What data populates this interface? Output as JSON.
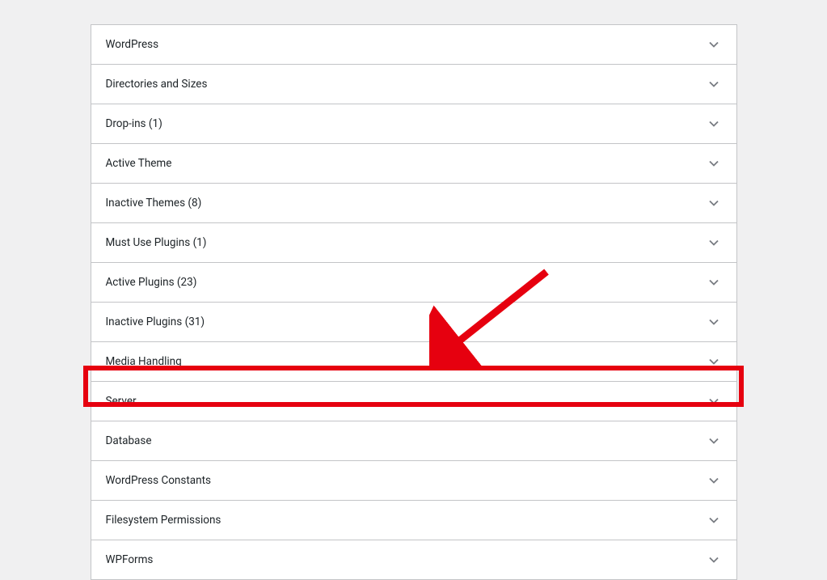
{
  "sections": [
    {
      "label": "WordPress"
    },
    {
      "label": "Directories and Sizes"
    },
    {
      "label": "Drop-ins (1)"
    },
    {
      "label": "Active Theme"
    },
    {
      "label": "Inactive Themes (8)"
    },
    {
      "label": "Must Use Plugins (1)"
    },
    {
      "label": "Active Plugins (23)"
    },
    {
      "label": "Inactive Plugins (31)"
    },
    {
      "label": "Media Handling"
    },
    {
      "label": "Server"
    },
    {
      "label": "Database"
    },
    {
      "label": "WordPress Constants"
    },
    {
      "label": "Filesystem Permissions"
    },
    {
      "label": "WPForms"
    }
  ],
  "highlighted_index": 9
}
